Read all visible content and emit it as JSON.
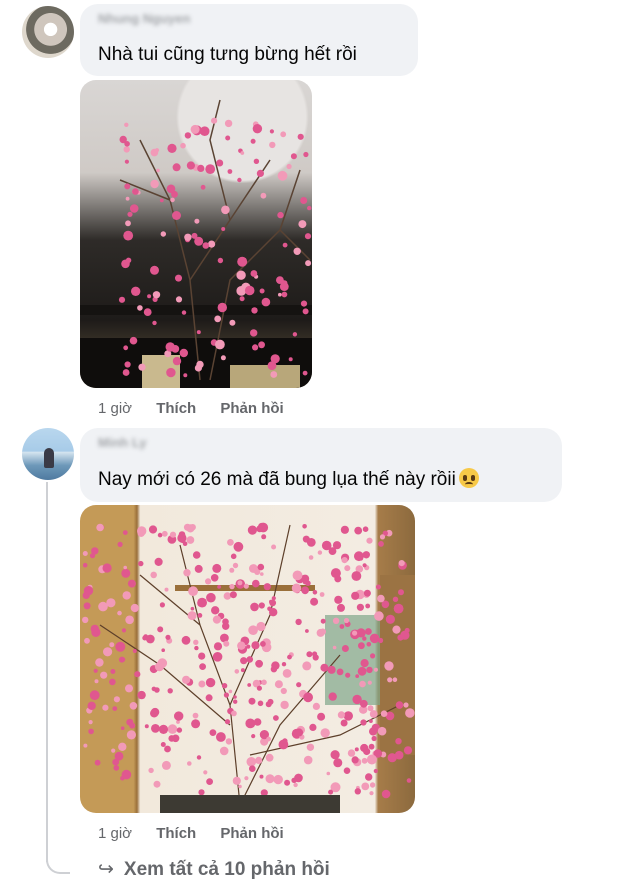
{
  "comments": [
    {
      "author": "Nhung Nguyen",
      "text": "Nhà tui cũng tưng bừng hết rồi",
      "time": "1 giờ",
      "like_label": "Thích",
      "reply_label": "Phản hồi"
    },
    {
      "author": "Minh Ly",
      "text": "Nay mới có 26 mà đã bung lụa thế này rồii",
      "emoji": "sad-face",
      "time": "1 giờ",
      "like_label": "Thích",
      "reply_label": "Phản hồi"
    }
  ],
  "view_more_replies": "Xem tất cả 10 phản hồi",
  "colors": {
    "bubble": "#f0f2f5",
    "meta_text": "#65676b",
    "text": "#050505",
    "blossom": "#e0578f"
  }
}
